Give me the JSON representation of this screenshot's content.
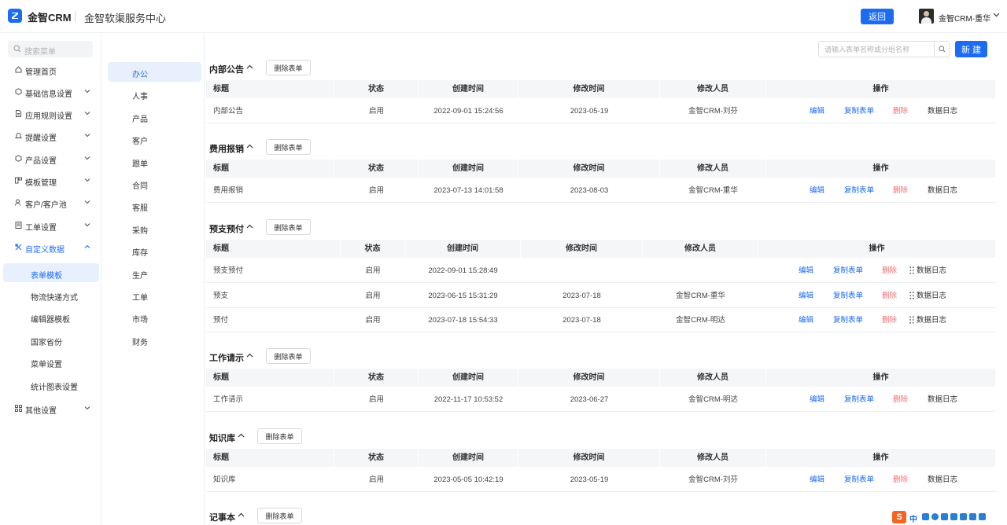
{
  "header": {
    "logo_text": "金智CRM",
    "app_title": "金智软渠服务中心",
    "back_label": "返回",
    "user_name": "金智CRM-重华"
  },
  "sidebar": {
    "search_placeholder": "搜索菜单",
    "items": [
      {
        "label": "管理首页",
        "icon": "home-icon",
        "has_chevron": false
      },
      {
        "label": "基础信息设置",
        "icon": "cube-icon",
        "has_chevron": true
      },
      {
        "label": "应用规则设置",
        "icon": "document-icon",
        "has_chevron": true
      },
      {
        "label": "提醒设置",
        "icon": "bell-icon",
        "has_chevron": true
      },
      {
        "label": "产品设置",
        "icon": "cube-icon",
        "has_chevron": true
      },
      {
        "label": "模板管理",
        "icon": "template-icon",
        "has_chevron": true
      },
      {
        "label": "客户/客户池",
        "icon": "users-icon",
        "has_chevron": true
      },
      {
        "label": "工单设置",
        "icon": "ticket-icon",
        "has_chevron": true
      },
      {
        "label": "自定义数据",
        "icon": "custom-data-icon",
        "has_chevron": true,
        "expanded": true
      }
    ],
    "sub_items": [
      {
        "label": "表单模板",
        "active": true
      },
      {
        "label": "物流快递方式"
      },
      {
        "label": "编辑器模板"
      },
      {
        "label": "国家省份"
      },
      {
        "label": "菜单设置"
      },
      {
        "label": "统计图表设置"
      }
    ],
    "other": {
      "label": "其他设置",
      "icon": "grid-icon"
    }
  },
  "categories": [
    "办公",
    "人事",
    "产品",
    "客户",
    "跟单",
    "合同",
    "客服",
    "采购",
    "库存",
    "生产",
    "工单",
    "市场",
    "财务"
  ],
  "toolbar": {
    "search_placeholder": "请输入表单名称或分组名称",
    "new_label": "新 建"
  },
  "common": {
    "delete_form_label": "删除表单",
    "columns": [
      "标题",
      "状态",
      "创建时间",
      "修改时间",
      "修改人员",
      "操作"
    ],
    "actions": {
      "edit": "编辑",
      "copy": "复制表单",
      "delete": "删除",
      "log": "数据日志"
    }
  },
  "sections": [
    {
      "title": "内部公告",
      "rows": [
        {
          "title": "内部公告",
          "status": "启用",
          "created": "2022-09-01 15:24:56",
          "modified": "2023-05-19",
          "modifier": "金智CRM-刘芬"
        }
      ]
    },
    {
      "title": "费用报销",
      "rows": [
        {
          "title": "费用报销",
          "status": "启用",
          "created": "2023-07-13 14:01:58",
          "modified": "2023-08-03",
          "modifier": "金智CRM-重华"
        }
      ]
    },
    {
      "title": "预支预付",
      "draggable": true,
      "rows": [
        {
          "title": "预支预付",
          "status": "启用",
          "created": "2022-09-01 15:28:49",
          "modified": "",
          "modifier": ""
        },
        {
          "title": "预支",
          "status": "启用",
          "created": "2023-06-15 15:31:29",
          "modified": "2023-07-18",
          "modifier": "金智CRM-重华"
        },
        {
          "title": "预付",
          "status": "启用",
          "created": "2023-07-18 15:54:33",
          "modified": "2023-07-18",
          "modifier": "金智CRM-明达"
        }
      ]
    },
    {
      "title": "工作请示",
      "rows": [
        {
          "title": "工作请示",
          "status": "启用",
          "created": "2022-11-17 10:53:52",
          "modified": "2023-06-27",
          "modifier": "金智CRM-明达"
        }
      ]
    },
    {
      "title": "知识库",
      "rows": [
        {
          "title": "知识库",
          "status": "启用",
          "created": "2023-05-05 10:42:19",
          "modified": "2023-05-19",
          "modifier": "金智CRM-刘芬"
        }
      ]
    },
    {
      "title": "记事本",
      "rows": []
    }
  ],
  "tray": {
    "text": "中"
  },
  "colors": {
    "accent": "#1d6cf0",
    "danger": "#f56c6c",
    "header_bg": "#f5f6f8"
  }
}
